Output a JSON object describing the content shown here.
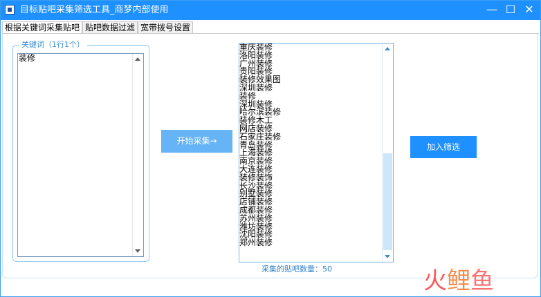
{
  "window": {
    "title": "目标贴吧采集筛选工具_商梦内部使用",
    "minimize": "—",
    "maximize": "☐",
    "close": "✕"
  },
  "tabs": [
    "根据关键词采集贴吧",
    "贴吧数据过滤",
    "宽带拨号设置"
  ],
  "keywords": {
    "group_label": "关键词（1行1个）",
    "value": "装修"
  },
  "actions": {
    "start_label": "开始采集→",
    "add_label": "加入筛选"
  },
  "results": {
    "items": [
      "重庆装修",
      "洛阳装修",
      "广州装修",
      "贵阳装修",
      "装修效果图",
      "深圳装修",
      "装修",
      "深圳装修",
      "哈尔滨装修",
      "装修木工",
      "网店装修",
      "石家庄装修",
      "青岛装修",
      "上海装修",
      "南京装修",
      "大连装修",
      "装修装饰",
      "长沙装修",
      "别墅装修",
      "店铺装修",
      "成都装修",
      "苏州装修",
      "潍坊装修",
      "沈阳装修",
      "郑州装修"
    ],
    "count_text": "采集的贴吧数量：50"
  },
  "watermark": {
    "part1": "火",
    "part2": "鲤",
    "part3": "鱼"
  }
}
